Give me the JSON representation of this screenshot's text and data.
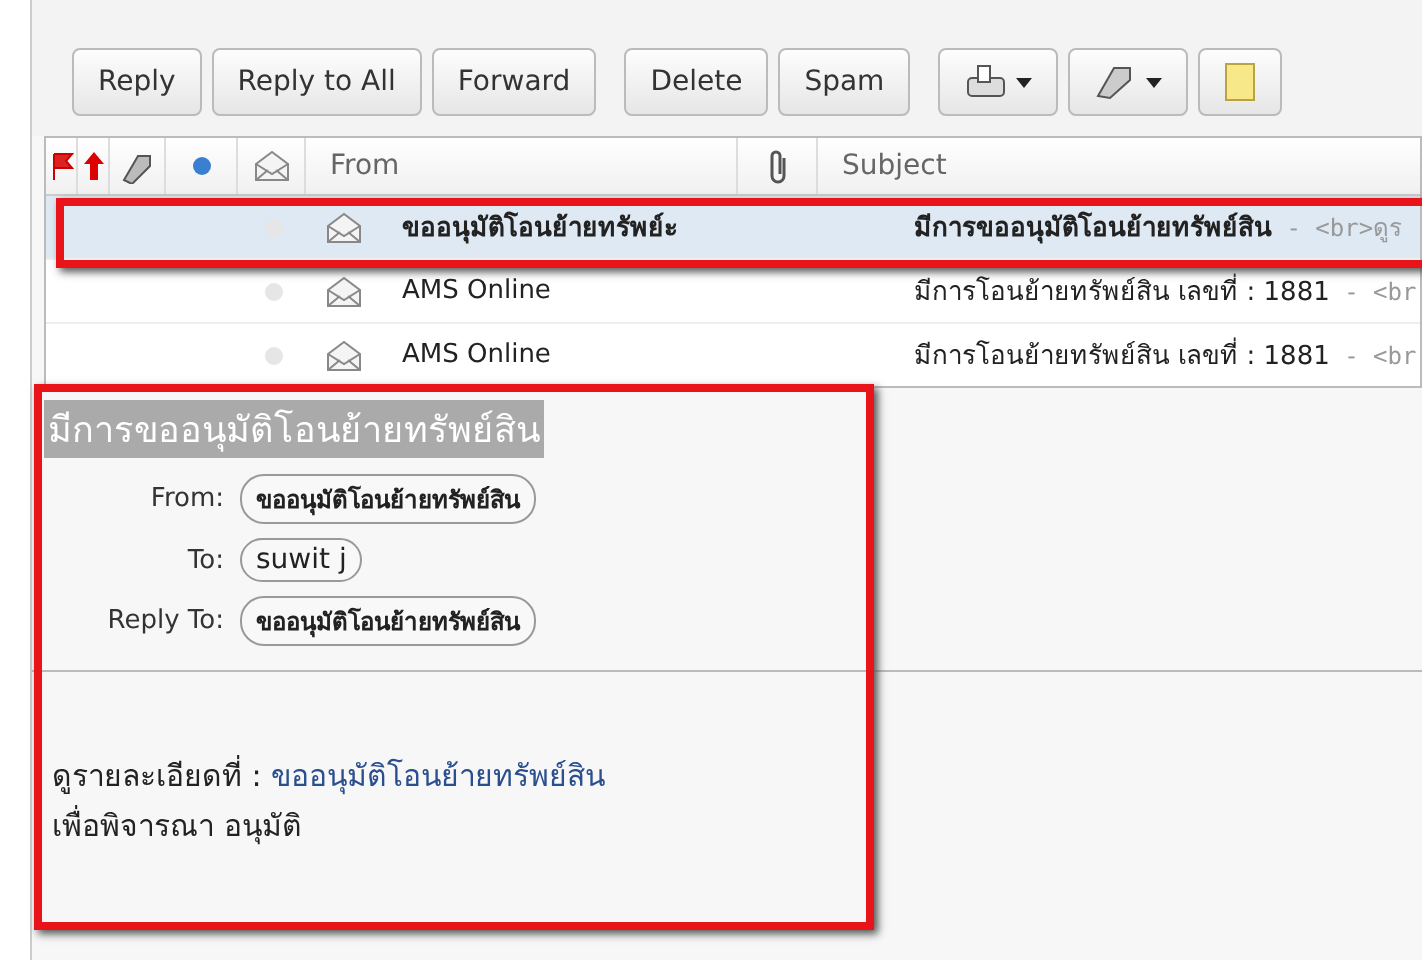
{
  "toolbar": {
    "groups": [
      [
        "Reply",
        "Reply to All",
        "Forward"
      ],
      [
        "Delete",
        "Spam"
      ]
    ]
  },
  "message_list": {
    "columns": {
      "from": "From",
      "subject": "Subject"
    },
    "rows": [
      {
        "from": "ขออนุมัติโอนย้ายทรัพย์ะ",
        "subject": "มีการขออนุมัติโอนย้ายทรัพย์สิน",
        "preview": " - <br>ดูร",
        "selected": true
      },
      {
        "from": "AMS Online",
        "subject": "มีการโอนย้ายทรัพย์สิน เลขที่ : 1881",
        "preview": " - <br",
        "selected": false
      },
      {
        "from": "AMS Online",
        "subject": "มีการโอนย้ายทรัพย์สิน เลขที่ : 1881",
        "preview": " - <br",
        "selected": false
      }
    ]
  },
  "preview": {
    "subject": "มีการขออนุมัติโอนย้ายทรัพย์สิน",
    "headers": [
      {
        "label": "From:",
        "value": "ขออนุมัติโอนย้ายทรัพย์สิน"
      },
      {
        "label": "To:",
        "value": "suwit j"
      },
      {
        "label": "Reply To:",
        "value": "ขออนุมัติโอนย้ายทรัพย์สิน"
      }
    ],
    "body": {
      "prefix": "ดูรายละเอียดที่ : ",
      "link": "ขออนุมัติโอนย้ายทรัพย์สิน",
      "line2": "เพื่อพิจารณา อนุมัติ"
    }
  }
}
